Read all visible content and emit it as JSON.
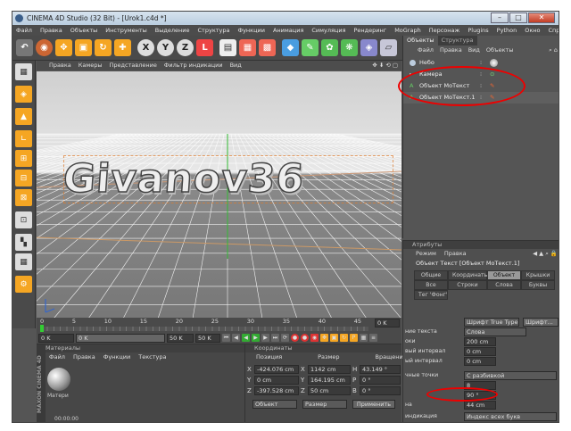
{
  "title": "CINEMA 4D Studio (32 Bit) - [Urok1.c4d *]",
  "menu": [
    "Файл",
    "Правка",
    "Объекты",
    "Инструменты",
    "Выделение",
    "Структура",
    "Функции",
    "Анимация",
    "Симуляция",
    "Рендеринг",
    "MoGraph",
    "Персонаж",
    "Plugins",
    "Python",
    "Окно",
    "Справка"
  ],
  "viewport": {
    "menu": [
      "Правка",
      "Камеры",
      "Представление",
      "Фильтр индикации",
      "Вид"
    ],
    "text3d": "Givanov36"
  },
  "timeline": {
    "ticks": [
      "0",
      "5",
      "10",
      "15",
      "20",
      "25",
      "30",
      "35",
      "40",
      "45",
      "50"
    ],
    "frame": "0 K",
    "start": "0 K",
    "end": "50 K",
    "mid1": "0 K",
    "mid2": "50 K"
  },
  "materials": {
    "header": "Материалы",
    "menu": [
      "Файл",
      "Правка",
      "Функции",
      "Текстура"
    ],
    "mat_label": "Матери",
    "status": "00:00:00"
  },
  "coords": {
    "header": "Координаты",
    "cols": [
      "Позиция",
      "Размер",
      "Вращение"
    ],
    "rows": [
      {
        "axis": "X",
        "pos": "-424.076 cm",
        "size_axis": "X",
        "size": "1142 cm",
        "rot_axis": "H",
        "rot": "43.149 °"
      },
      {
        "axis": "Y",
        "pos": "0 cm",
        "size_axis": "Y",
        "size": "164.195 cm",
        "rot_axis": "P",
        "rot": "0 °"
      },
      {
        "axis": "Z",
        "pos": "-397.528 cm",
        "size_axis": "Z",
        "size": "50 cm",
        "rot_axis": "B",
        "rot": "0 °"
      }
    ],
    "mode1": "Объект",
    "mode2": "Размер",
    "apply": "Применить"
  },
  "objects": {
    "tabs": [
      "Объекты",
      "Структура"
    ],
    "menu": [
      "Файл",
      "Правка",
      "Вид",
      "Объекты"
    ],
    "items": [
      "Небо",
      "Камера",
      "Объект МоТекст",
      "Объект МоТекст.1"
    ]
  },
  "attributes": {
    "header": "Атрибуты",
    "menu": [
      "Режим",
      "Правка"
    ],
    "obj_title": "Объект Текст [Объект МоТекст.1]",
    "tabs_row1": [
      "Общие",
      "Координаты",
      "Объект",
      "Крышки"
    ],
    "tabs_row2": [
      "Все",
      "Строки",
      "Слова",
      "Буквы"
    ],
    "tabs_row3": [
      "Тег 'Фонг'"
    ],
    "font_type": "Шрифт True Type",
    "font_btn": "Шрифт...",
    "rows": [
      {
        "label": "ние текста",
        "value": "Слова"
      },
      {
        "label": "оки",
        "value": "200 cm"
      },
      {
        "label": "вый интервал",
        "value": "0 cm"
      },
      {
        "label": "ый интервал",
        "value": "0 cm"
      },
      {
        "label": "чные точки",
        "value": "С разбивкой"
      },
      {
        "label": "",
        "value": "8"
      },
      {
        "label": "",
        "value": "90 °"
      },
      {
        "label": "на",
        "value": "44 cm"
      },
      {
        "label": "индикация",
        "value": "Индекс всех букв"
      }
    ]
  },
  "colors": {
    "accent": "#e00000",
    "panel": "#4a4a4a"
  }
}
